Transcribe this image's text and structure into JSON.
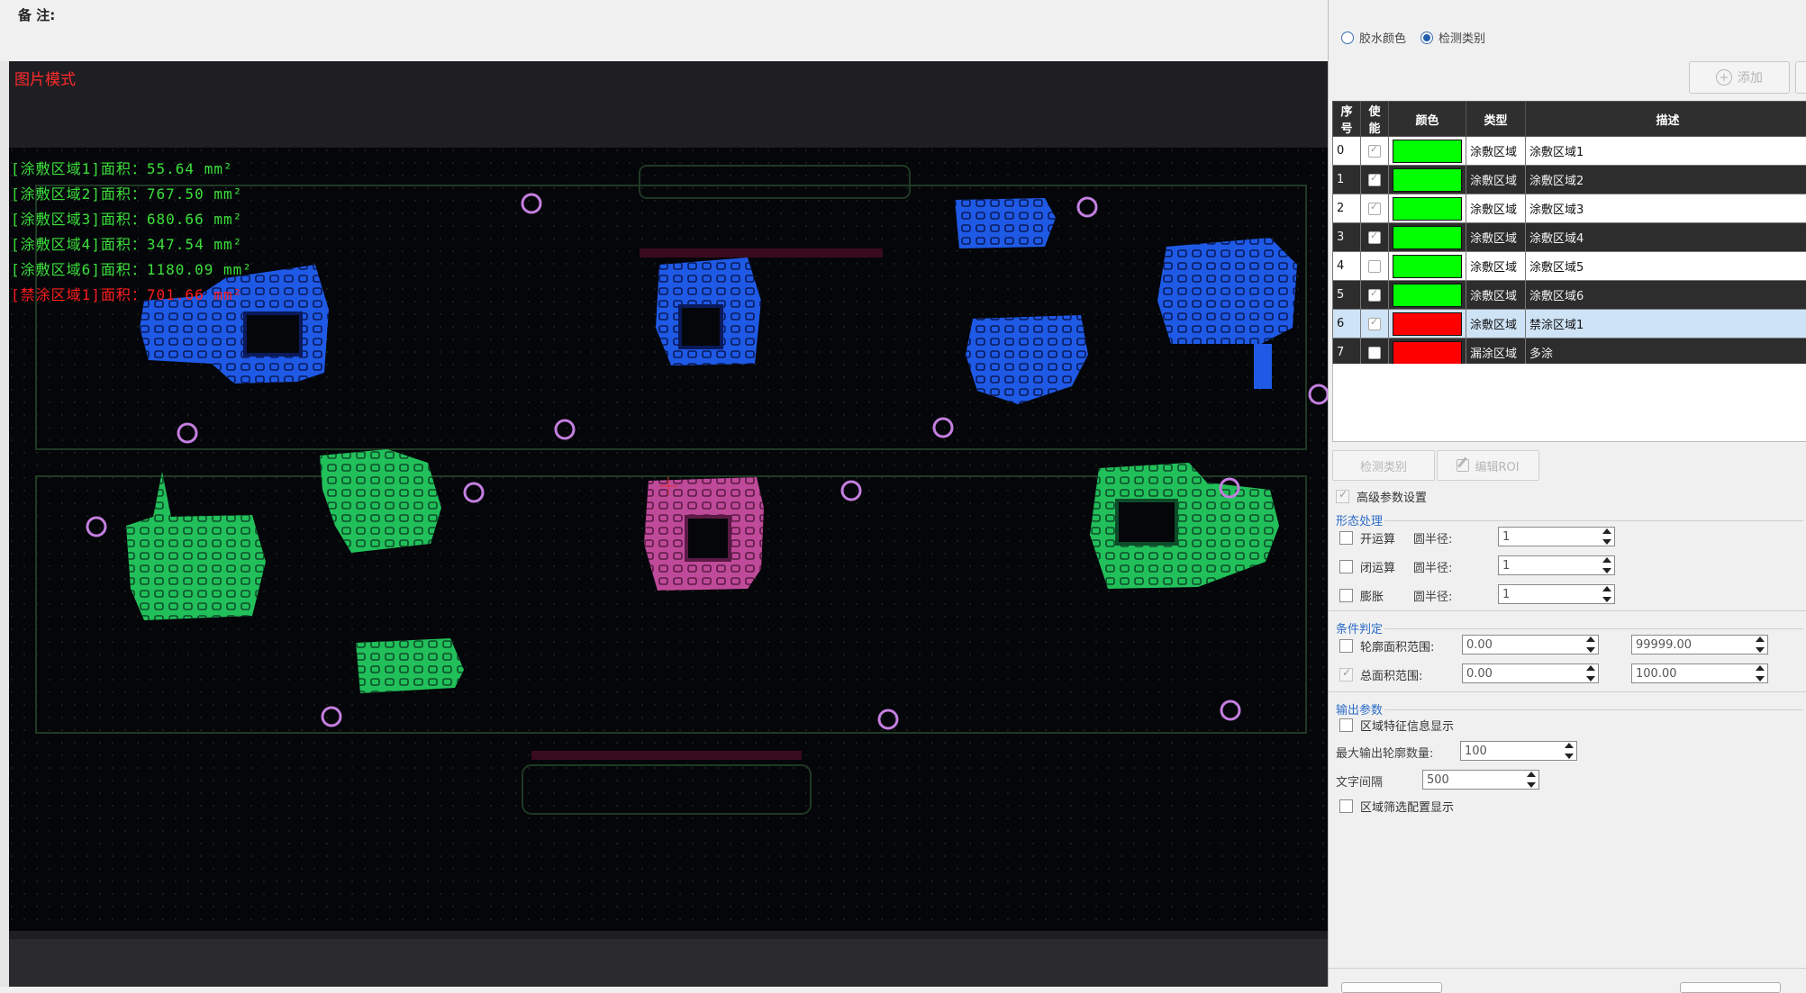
{
  "header": {
    "remark_label": "备 注:"
  },
  "viewer": {
    "mode_label": "图片模式",
    "area_lines": [
      {
        "text": "[涂敷区域1]面积：55.64 mm²",
        "color": "green"
      },
      {
        "text": "[涂敷区域2]面积：767.50 mm²",
        "color": "green"
      },
      {
        "text": "[涂敷区域3]面积：680.66 mm²",
        "color": "green"
      },
      {
        "text": "[涂敷区域4]面积：347.54 mm²",
        "color": "green"
      },
      {
        "text": "[涂敷区域6]面积：1180.09 mm²",
        "color": "green"
      },
      {
        "text": "[禁涂区域1]面积：701.66 mm²",
        "color": "red"
      }
    ]
  },
  "panel": {
    "radios": [
      {
        "label": "胶水颜色",
        "selected": false
      },
      {
        "label": "检测类别",
        "selected": true
      }
    ],
    "add_button": "添加",
    "table": {
      "headers": [
        "序号",
        "使能",
        "颜色",
        "类型",
        "描述"
      ],
      "rows": [
        {
          "index": "0",
          "enabled": true,
          "color": "#00ff00",
          "type": "涂敷区域",
          "desc": "涂敷区域1",
          "style": "white"
        },
        {
          "index": "1",
          "enabled": true,
          "color": "#00ff00",
          "type": "涂敷区域",
          "desc": "涂敷区域2",
          "style": "dark"
        },
        {
          "index": "2",
          "enabled": true,
          "color": "#00ff00",
          "type": "涂敷区域",
          "desc": "涂敷区域3",
          "style": "white"
        },
        {
          "index": "3",
          "enabled": true,
          "color": "#00ff00",
          "type": "涂敷区域",
          "desc": "涂敷区域4",
          "style": "dark"
        },
        {
          "index": "4",
          "enabled": false,
          "color": "#00ff00",
          "type": "涂敷区域",
          "desc": "涂敷区域5",
          "style": "white"
        },
        {
          "index": "5",
          "enabled": true,
          "color": "#00ff00",
          "type": "涂敷区域",
          "desc": "涂敷区域6",
          "style": "dark"
        },
        {
          "index": "6",
          "enabled": true,
          "color": "#ff0000",
          "type": "涂敷区域",
          "desc": "禁涂区域1",
          "style": "sel"
        },
        {
          "index": "7",
          "enabled": false,
          "color": "#ff0000",
          "type": "漏涂区域",
          "desc": "多涂",
          "style": "dark"
        }
      ]
    },
    "detect_button": "检测类别",
    "edit_roi_button": "编辑ROI",
    "advanced_label": "高级参数设置",
    "morph": {
      "title": "形态处理",
      "radius_label": "圆半径:",
      "items": [
        {
          "label": "开运算",
          "value": "1"
        },
        {
          "label": "闭运算",
          "value": "1"
        },
        {
          "label": "膨胀",
          "value": "1"
        }
      ]
    },
    "condition": {
      "title": "条件判定",
      "contour_label": "轮廓面积范围:",
      "contour_min": "0.00",
      "contour_max": "99999.00",
      "total_label": "总面积范围:",
      "total_min": "0.00",
      "total_max": "100.00"
    },
    "output": {
      "title": "输出参数",
      "feature_label": "区域特征信息显示",
      "max_contours_label": "最大输出轮廓数量:",
      "max_contours_value": "100",
      "text_gap_label": "文字间隔",
      "text_gap_value": "500",
      "filter_label": "区域筛选配置显示"
    }
  }
}
